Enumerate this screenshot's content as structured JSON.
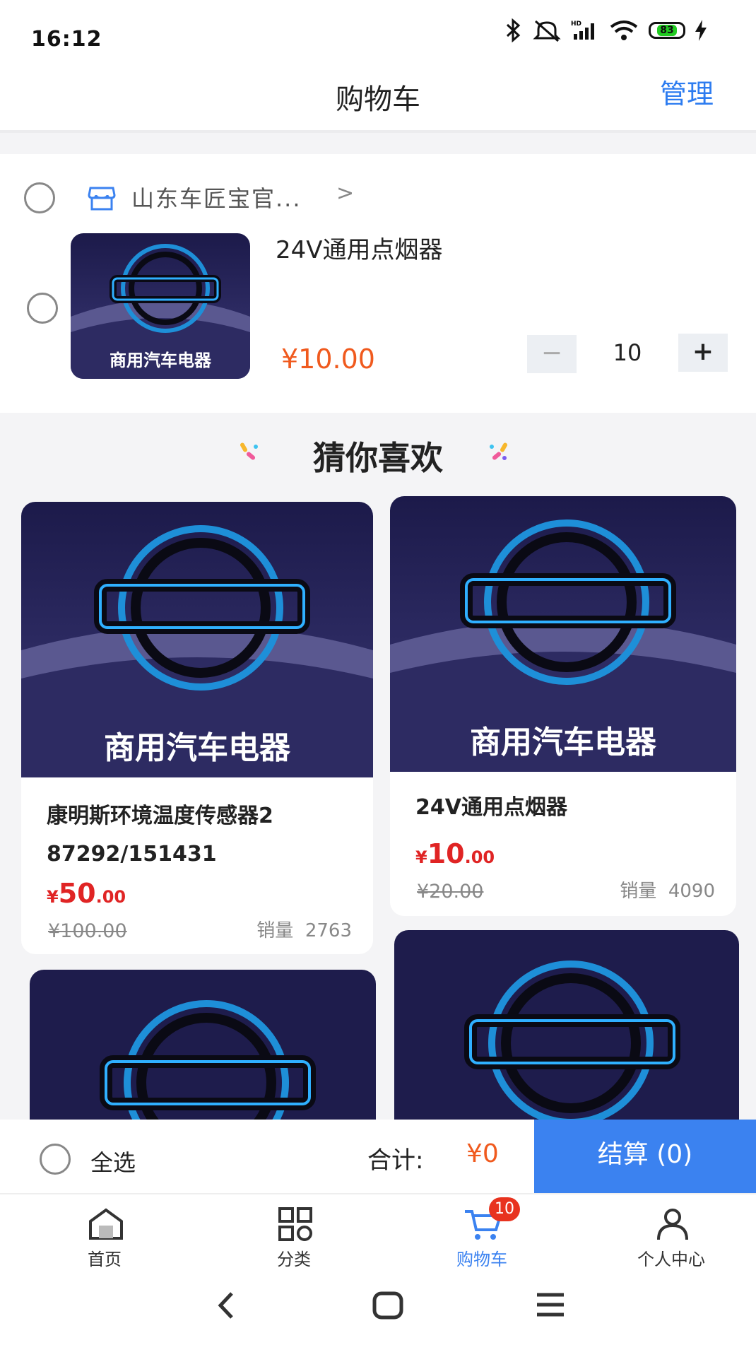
{
  "status_bar": {
    "time": "16:12",
    "battery": "83"
  },
  "header": {
    "title": "购物车",
    "manage": "管理"
  },
  "shop": {
    "name": "山东车匠宝官..."
  },
  "cart_item": {
    "name": "24V通用点烟器",
    "price": "¥10.00",
    "quantity": "10",
    "minus": "−",
    "plus": "+",
    "image_text": "商用汽车电器"
  },
  "recommend": {
    "title": "猜你喜欢",
    "products": [
      {
        "name_line1": "康明斯环境温度传感器2",
        "name_line2": "87292/151431",
        "price_yen": "¥",
        "price_int": "50",
        "price_dec": ".00",
        "original": "¥100.00",
        "sales_label": "销量",
        "sales": "2763",
        "image_text": "商用汽车电器"
      },
      {
        "name_line1": "24V通用点烟器",
        "name_line2": "",
        "price_yen": "¥",
        "price_int": "10",
        "price_dec": ".00",
        "original": "¥20.00",
        "sales_label": "销量",
        "sales": "4090",
        "image_text": "商用汽车电器"
      },
      {
        "image_text": ""
      },
      {
        "image_text": ""
      }
    ]
  },
  "checkout": {
    "select_all": "全选",
    "total_label": "合计:",
    "total_value": "¥0",
    "button": "结算 (0)"
  },
  "tabs": [
    {
      "label": "首页",
      "icon": "home-icon"
    },
    {
      "label": "分类",
      "icon": "grid-icon"
    },
    {
      "label": "购物车",
      "icon": "cart-icon",
      "badge": "10"
    },
    {
      "label": "个人中心",
      "icon": "user-icon"
    }
  ],
  "colors": {
    "accent": "#3b82f0",
    "price": "#f05a1e",
    "sale_price": "#e02424",
    "badge": "#e8331f"
  }
}
